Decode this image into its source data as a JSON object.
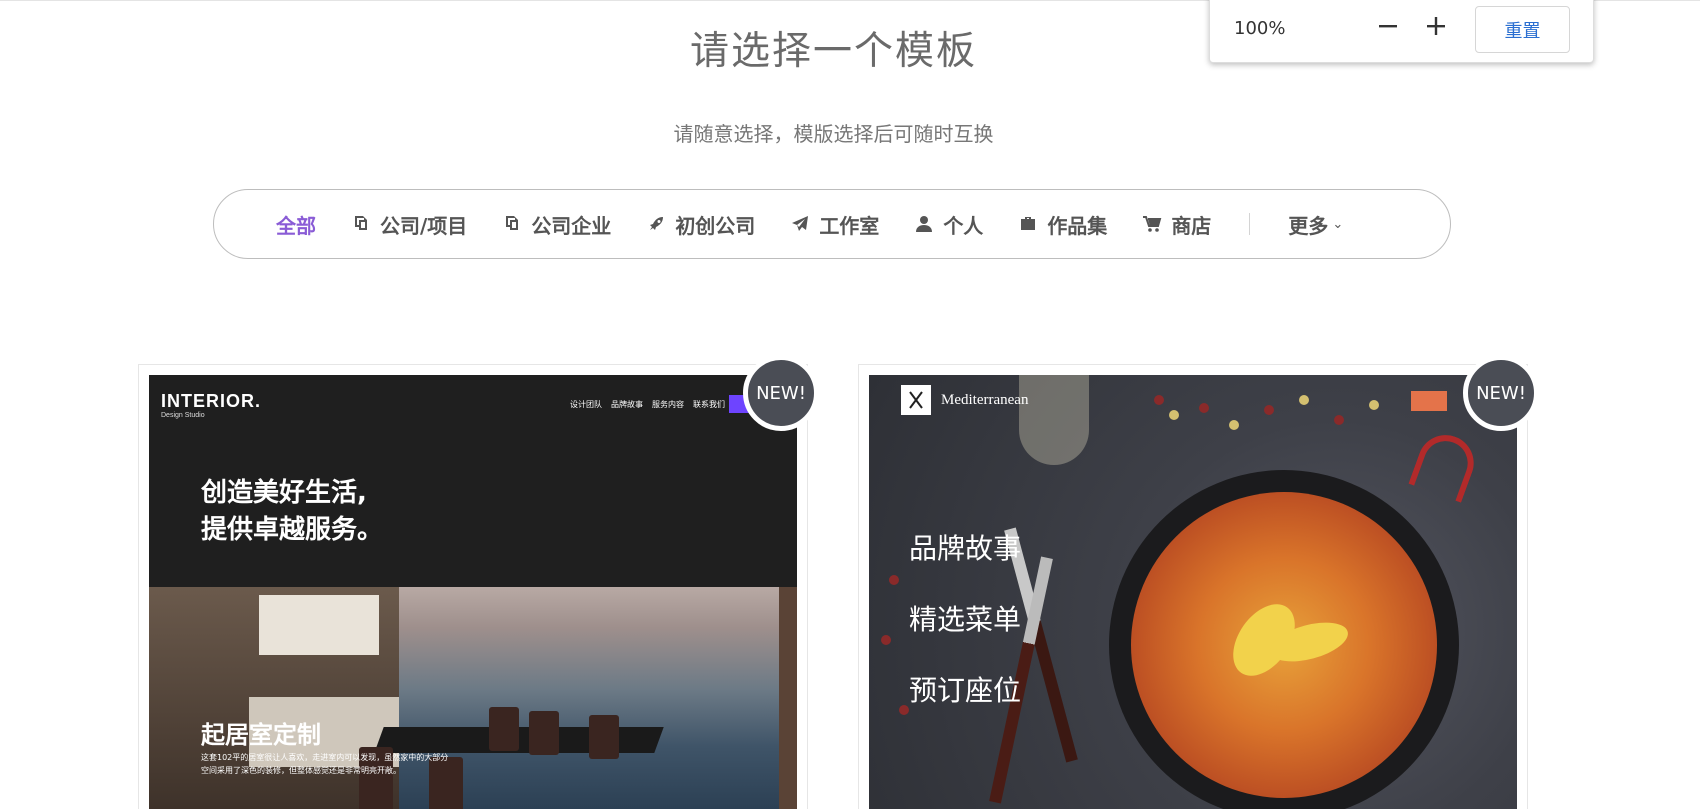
{
  "header": {
    "title": "请选择一个模板",
    "subtitle": "请随意选择，模版选择后可随时互换"
  },
  "filters": [
    {
      "label": "全部",
      "icon": "",
      "active": true
    },
    {
      "label": "公司/项目",
      "icon": "copy-icon"
    },
    {
      "label": "公司企业",
      "icon": "copy-icon"
    },
    {
      "label": "初创公司",
      "icon": "rocket-icon"
    },
    {
      "label": "工作室",
      "icon": "paper-plane-icon"
    },
    {
      "label": "个人",
      "icon": "user-icon"
    },
    {
      "label": "作品集",
      "icon": "briefcase-icon"
    },
    {
      "label": "商店",
      "icon": "cart-icon"
    }
  ],
  "filters_more": {
    "label": "更多",
    "icon": "chevron-down-icon"
  },
  "zoom": {
    "level": "100%",
    "minus_icon": "minus-icon",
    "plus_icon": "plus-icon",
    "reset_label": "重置"
  },
  "templates": [
    {
      "badge": "NEW!",
      "logo": "INTERIOR.",
      "logo_sub": "Design Studio",
      "nav": [
        "设计团队",
        "品牌故事",
        "服务内容",
        "联系我们"
      ],
      "hero_line1": "创造美好生活,",
      "hero_line2": "提供卓越服务。",
      "sub_title": "起居室定制",
      "sub_desc_line1": "这套102平的居室很让人喜欢，走进室内可以发现，虽然家中的大部分",
      "sub_desc_line2": "空间采用了深色的装修，但整体感觉还是非常明亮开敞。"
    },
    {
      "badge": "NEW!",
      "logo": "Mediterranean",
      "logo_icon": "fork-knife-icon",
      "menu": [
        "品牌故事",
        "精选菜单",
        "预订座位"
      ]
    }
  ],
  "colors": {
    "accent": "#8a5cd6",
    "badge": "#4a4d55",
    "reset_text": "#2b6fd1"
  }
}
